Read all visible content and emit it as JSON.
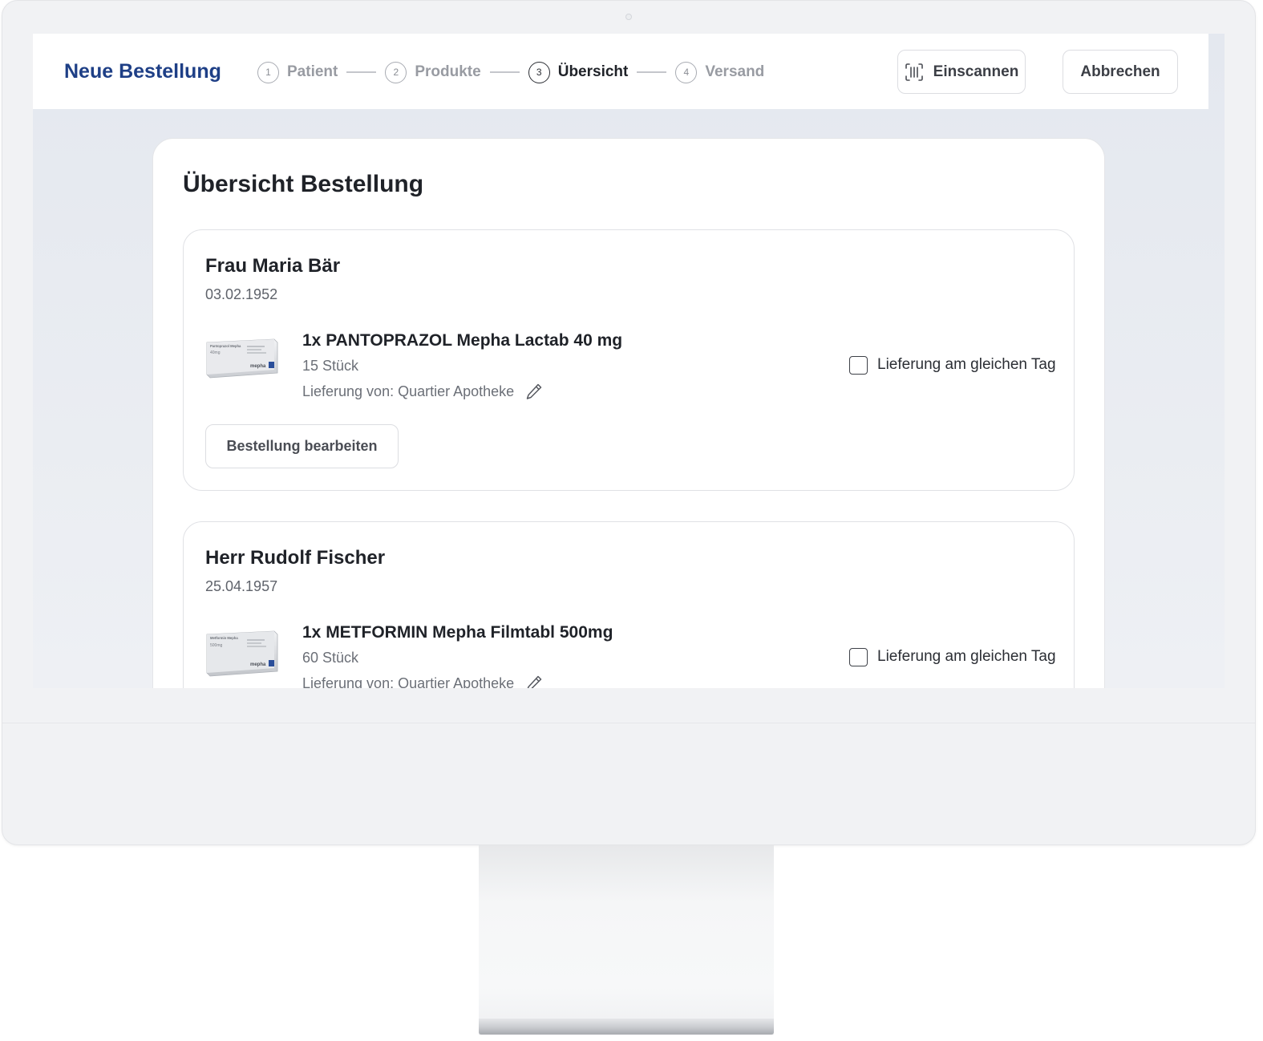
{
  "header": {
    "title": "Neue Bestellung",
    "steps": [
      {
        "number": "1",
        "label": "Patient",
        "state": "inactive"
      },
      {
        "number": "2",
        "label": "Produkte",
        "state": "inactive"
      },
      {
        "number": "3",
        "label": "Übersicht",
        "state": "active"
      },
      {
        "number": "4",
        "label": "Versand",
        "state": "inactive"
      }
    ],
    "scan_label": "Einscannen",
    "scan_icon": "barcode-scan-icon",
    "cancel_label": "Abbrechen"
  },
  "main": {
    "title": "Übersicht Bestellung",
    "orders": [
      {
        "patient_name": "Frau Maria Bär",
        "birth_date": "03.02.1952",
        "product": {
          "name": "1x PANTOPRAZOL Mepha Lactab 40 mg",
          "quantity": "15 Stück",
          "delivery_from": "Lieferung von: Quartier Apotheke",
          "image_icon": "medicine-box-image",
          "box_brand": "Pantoprazol Mepha",
          "box_strength": "40mg",
          "box_maker": "mepha"
        },
        "same_day_label": "Lieferung am gleichen Tag",
        "same_day_checked": false,
        "edit_button_label": "Bestellung bearbeiten"
      },
      {
        "patient_name": "Herr Rudolf Fischer",
        "birth_date": "25.04.1957",
        "product": {
          "name": "1x METFORMIN Mepha Filmtabl 500mg",
          "quantity": "60 Stück",
          "delivery_from": "Lieferung von: Quartier Apotheke",
          "image_icon": "medicine-box-image",
          "box_brand": "Metformin Mepha",
          "box_strength": "500mg",
          "box_maker": "mepha"
        },
        "same_day_label": "Lieferung am gleichen Tag",
        "same_day_checked": false
      }
    ]
  },
  "colors": {
    "brand": "#1e3f86",
    "text": "#1f2228",
    "muted": "#6b6f77",
    "screen_bg": "#e4e8ef",
    "device": "#f1f2f4"
  }
}
